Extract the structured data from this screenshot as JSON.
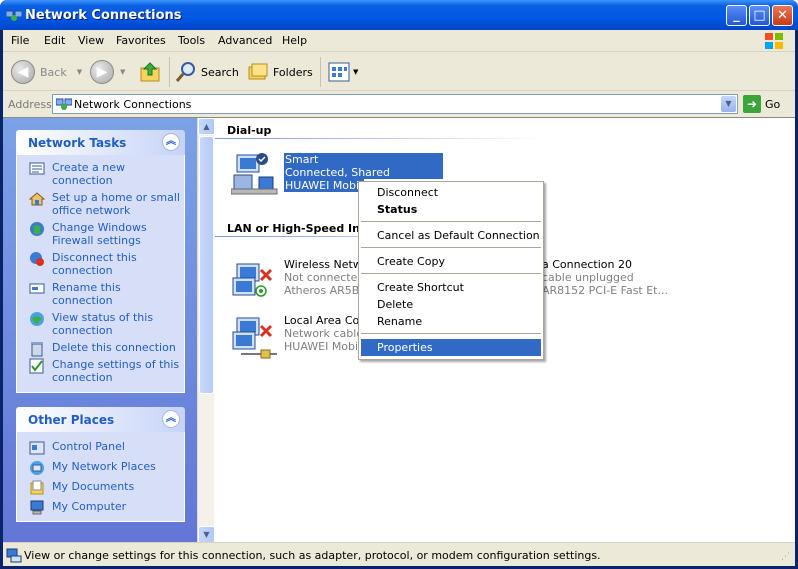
{
  "window": {
    "title": "Network Connections",
    "min": "_",
    "max": "□",
    "close": "✕"
  },
  "menu": [
    "File",
    "Edit",
    "View",
    "Favorites",
    "Tools",
    "Advanced",
    "Help"
  ],
  "toolbar": {
    "back": "Back",
    "search": "Search",
    "folders": "Folders"
  },
  "address": {
    "label": "Address",
    "value": "Network Connections",
    "go": "Go"
  },
  "tasks": {
    "title": "Network Tasks",
    "items": [
      "Create a new connection",
      "Set up a home or small office network",
      "Change Windows Firewall settings",
      "Disconnect this connection",
      "Rename this connection",
      "View status of this connection",
      "Delete this connection",
      "Change settings of this connection"
    ]
  },
  "places": {
    "title": "Other Places",
    "items": [
      "Control Panel",
      "My Network Places",
      "My Documents",
      "My Computer"
    ]
  },
  "groups": {
    "dialup": "Dial-up",
    "lan": "LAN or High-Speed Inte"
  },
  "connections": {
    "smart": {
      "name": "Smart",
      "status": "Connected, Shared",
      "device": "HUAWEI Mobile"
    },
    "wireless": {
      "name": "Wireless Networ",
      "status": "Not connected",
      "device": "Atheros AR5B95"
    },
    "local": {
      "name": "Local Area Conn",
      "status": "Network cable u",
      "device": "HUAWEI Mobile"
    },
    "local20": {
      "name": "a Connection 20",
      "status": "cable unplugged",
      "device": "AR8152 PCI-E Fast Et..."
    }
  },
  "context_menu": {
    "disconnect": "Disconnect",
    "status": "Status",
    "default": "Cancel as Default Connection",
    "copy": "Create Copy",
    "shortcut": "Create Shortcut",
    "delete": "Delete",
    "rename": "Rename",
    "properties": "Properties"
  },
  "statusbar": "View or change settings for this connection, such as adapter, protocol, or modem configuration settings.",
  "colors": {
    "accent": "#316ac5",
    "task_link": "#215dc6",
    "titlebar": "#0058e6"
  }
}
